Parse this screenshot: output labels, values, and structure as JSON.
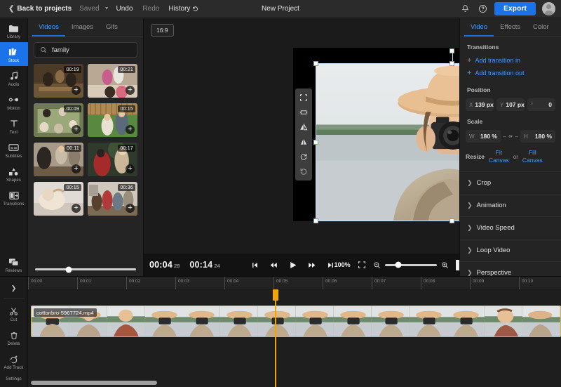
{
  "topbar": {
    "back_label": "Back to projects",
    "saved_label": "Saved",
    "undo_label": "Undo",
    "redo_label": "Redo",
    "history_label": "History",
    "project_title": "New Project",
    "export_label": "Export",
    "accent_color": "#1a73e8"
  },
  "rail": {
    "items": [
      {
        "label": "Library",
        "icon": "folder-icon"
      },
      {
        "label": "Stock",
        "icon": "stock-icon"
      },
      {
        "label": "Audio",
        "icon": "audio-icon"
      },
      {
        "label": "Motion",
        "icon": "motion-icon"
      },
      {
        "label": "Text",
        "icon": "text-icon"
      },
      {
        "label": "Subtitles",
        "icon": "subtitles-icon"
      },
      {
        "label": "Shapes",
        "icon": "shapes-icon"
      },
      {
        "label": "Transitions",
        "icon": "transitions-icon"
      },
      {
        "label": "Reviews",
        "icon": "reviews-icon"
      }
    ],
    "active_index": 1,
    "bottom_items": [
      {
        "label": "Cut",
        "icon": "scissors-icon"
      },
      {
        "label": "Delete",
        "icon": "trash-icon"
      }
    ],
    "add_track_label": "Add Track",
    "settings_label": "Settings"
  },
  "media": {
    "tabs": [
      {
        "label": "Videos"
      },
      {
        "label": "Images"
      },
      {
        "label": "Gifs"
      }
    ],
    "active_tab": 0,
    "search": {
      "value": "family",
      "placeholder": "Search"
    },
    "thumbnails": [
      {
        "duration": "00:19"
      },
      {
        "duration": "00:21"
      },
      {
        "duration": "00:09"
      },
      {
        "duration": "00:15"
      },
      {
        "duration": "00:11"
      },
      {
        "duration": "00:17"
      },
      {
        "duration": "00:15"
      },
      {
        "duration": "00:36"
      }
    ]
  },
  "canvas": {
    "ratio_badge": "16:9",
    "tools": [
      {
        "icon": "fit-icon"
      },
      {
        "icon": "center-horizontal-icon"
      },
      {
        "icon": "flip-horizontal-icon"
      },
      {
        "icon": "flip-vertical-icon"
      },
      {
        "icon": "rotate-right-icon"
      },
      {
        "icon": "rotate-left-icon"
      }
    ]
  },
  "playbar": {
    "current_time": "00:04",
    "current_frames": "28",
    "total_time": "00:14",
    "total_frames": "24",
    "zoom_percent": "100%",
    "controls": [
      {
        "icon": "skip-start-icon"
      },
      {
        "icon": "rewind-icon"
      },
      {
        "icon": "play-icon"
      },
      {
        "icon": "fast-forward-icon"
      },
      {
        "icon": "skip-end-icon"
      }
    ]
  },
  "timeline": {
    "ruler_ticks": [
      "00:00",
      "00:01",
      "00:02",
      "00:03",
      "00:04",
      "00:05",
      "00:06",
      "00:07",
      "00:08",
      "00:09",
      "00:10"
    ],
    "clip_name": "cottonbro-5967724.mp4",
    "playhead_color": "#f0a500",
    "clip_border_color": "#d3b248"
  },
  "right_panel": {
    "tabs": [
      {
        "label": "Video"
      },
      {
        "label": "Effects"
      },
      {
        "label": "Color"
      }
    ],
    "active_tab": 0,
    "transitions_title": "Transitions",
    "add_transition_in": "Add transition in",
    "add_transition_out": "Add transition out",
    "position_title": "Position",
    "position": {
      "x_key": "X",
      "x_value": "139 px",
      "y_key": "Y",
      "y_value": "107 px",
      "rot_key": "°",
      "rot_value": "0"
    },
    "scale_title": "Scale",
    "scale": {
      "w_key": "W",
      "w_value": "180 %",
      "h_key": "H",
      "h_value": "180 %"
    },
    "resize_label": "Resize",
    "fit_canvas": "Fit\nCanvas",
    "fit_canvas_l1": "Fit",
    "fit_canvas_l2": "Canvas",
    "or_label": "or",
    "fill_canvas_l1": "Fill",
    "fill_canvas_l2": "Canvas",
    "sections": [
      {
        "label": "Crop"
      },
      {
        "label": "Animation"
      },
      {
        "label": "Video Speed"
      },
      {
        "label": "Loop Video"
      },
      {
        "label": "Perspective"
      }
    ]
  }
}
